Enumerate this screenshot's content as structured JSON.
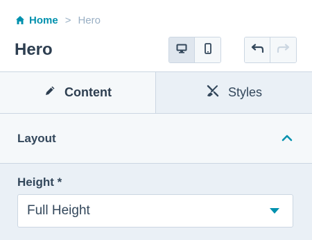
{
  "breadcrumb": {
    "home_label": "Home",
    "separator": ">",
    "current_label": "Hero"
  },
  "header": {
    "title": "Hero"
  },
  "device_toggle": {
    "selected": "desktop",
    "options": [
      "desktop",
      "mobile"
    ]
  },
  "history": {
    "undo_enabled": true,
    "redo_enabled": false
  },
  "tabs": [
    {
      "label": "Content",
      "icon": "pencil-icon",
      "active": true
    },
    {
      "label": "Styles",
      "icon": "brush-icon",
      "active": false
    }
  ],
  "section": {
    "title": "Layout",
    "expanded": true
  },
  "field": {
    "label": "Height *",
    "value": "Full Height"
  },
  "colors": {
    "accent": "#0091ae",
    "text": "#33475b",
    "border": "#cbd6e2",
    "muted": "#99afc4",
    "panel_bg": "#f5f8fa",
    "field_bg": "#eaf0f6"
  }
}
